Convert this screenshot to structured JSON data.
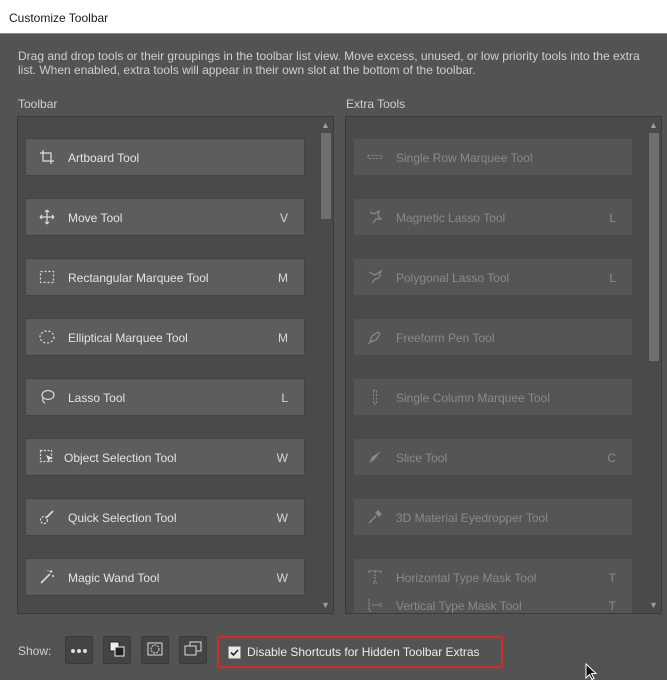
{
  "window": {
    "title": "Customize Toolbar"
  },
  "description": "Drag and drop tools or their groupings in the toolbar list view. Move excess, unused, or low priority tools into the extra list. When enabled, extra tools will appear in their own slot at the bottom of the toolbar.",
  "toolbar": {
    "label": "Toolbar",
    "tools": [
      {
        "name": "Artboard Tool",
        "key": "",
        "icon": "artboard-icon"
      },
      {
        "name": "Move Tool",
        "key": "V",
        "icon": "move-icon"
      },
      {
        "name": "Rectangular Marquee Tool",
        "key": "M",
        "icon": "rectangular-marquee-icon"
      },
      {
        "name": "Elliptical Marquee Tool",
        "key": "M",
        "icon": "elliptical-marquee-icon"
      },
      {
        "name": "Lasso Tool",
        "key": "L",
        "icon": "lasso-icon"
      },
      {
        "name": "Object Selection Tool",
        "key": "W",
        "icon": "object-selection-icon"
      },
      {
        "name": "Quick Selection Tool",
        "key": "W",
        "icon": "quick-selection-icon"
      },
      {
        "name": "Magic Wand Tool",
        "key": "W",
        "icon": "magic-wand-icon"
      }
    ]
  },
  "extra": {
    "label": "Extra Tools",
    "tools": [
      {
        "name": "Single Row Marquee Tool",
        "key": "",
        "icon": "single-row-marquee-icon"
      },
      {
        "name": "Magnetic Lasso Tool",
        "key": "L",
        "icon": "magnetic-lasso-icon"
      },
      {
        "name": "Polygonal Lasso Tool",
        "key": "L",
        "icon": "polygonal-lasso-icon"
      },
      {
        "name": "Freeform Pen Tool",
        "key": "",
        "icon": "freeform-pen-icon"
      },
      {
        "name": "Single Column Marquee Tool",
        "key": "",
        "icon": "single-column-marquee-icon"
      },
      {
        "name": "Slice Tool",
        "key": "C",
        "icon": "slice-icon"
      },
      {
        "name": "3D Material Eyedropper Tool",
        "key": "",
        "icon": "eyedropper-icon"
      },
      {
        "name": "Horizontal Type Mask Tool",
        "key": "T",
        "icon": "horizontal-type-mask-icon"
      },
      {
        "name": "Vertical Type Mask Tool",
        "key": "T",
        "icon": "vertical-type-mask-icon"
      }
    ]
  },
  "footer": {
    "show_label": "Show:",
    "checkbox_label": "Disable Shortcuts for Hidden Toolbar Extras",
    "checkbox_checked": true
  },
  "colors": {
    "highlight": "#d62a2a",
    "panel": "#4a4a4a",
    "background": "#535353"
  }
}
